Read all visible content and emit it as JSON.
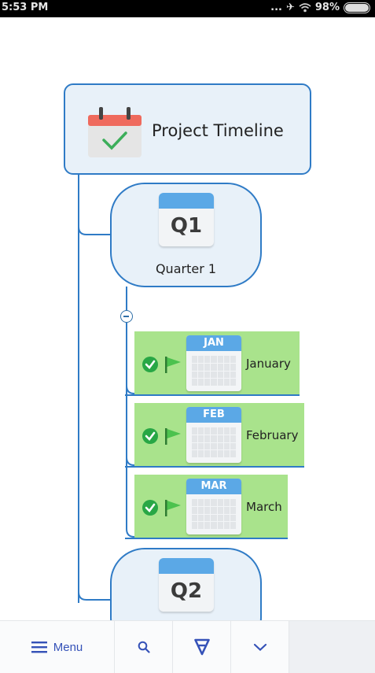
{
  "status_bar": {
    "time": "5:53 PM",
    "signal": "...",
    "airplane": "✈",
    "battery": "98%"
  },
  "mindmap": {
    "root": {
      "title": "Project Timeline",
      "icon": "calendar-check-icon"
    },
    "quarters": [
      {
        "badge": "Q1",
        "label": "Quarter 1"
      },
      {
        "badge": "Q2",
        "label": ""
      }
    ],
    "months": [
      {
        "tag": "JAN",
        "label": "January"
      },
      {
        "tag": "FEB",
        "label": "February"
      },
      {
        "tag": "MAR",
        "label": "March"
      }
    ]
  },
  "toolbar": {
    "menu_label": "Menu",
    "menu_icon": "hamburger-icon",
    "search_icon": "search-icon",
    "filter_icon": "filter-icon",
    "down_icon": "chevron-down-icon"
  },
  "colors": {
    "node_border": "#2f7bc6",
    "node_fill": "#e8f1f9",
    "month_fill": "#a9e38c",
    "calendar_band": "#5ba8e6",
    "check_green": "#28a745",
    "toolbar_accent": "#3552b8"
  }
}
